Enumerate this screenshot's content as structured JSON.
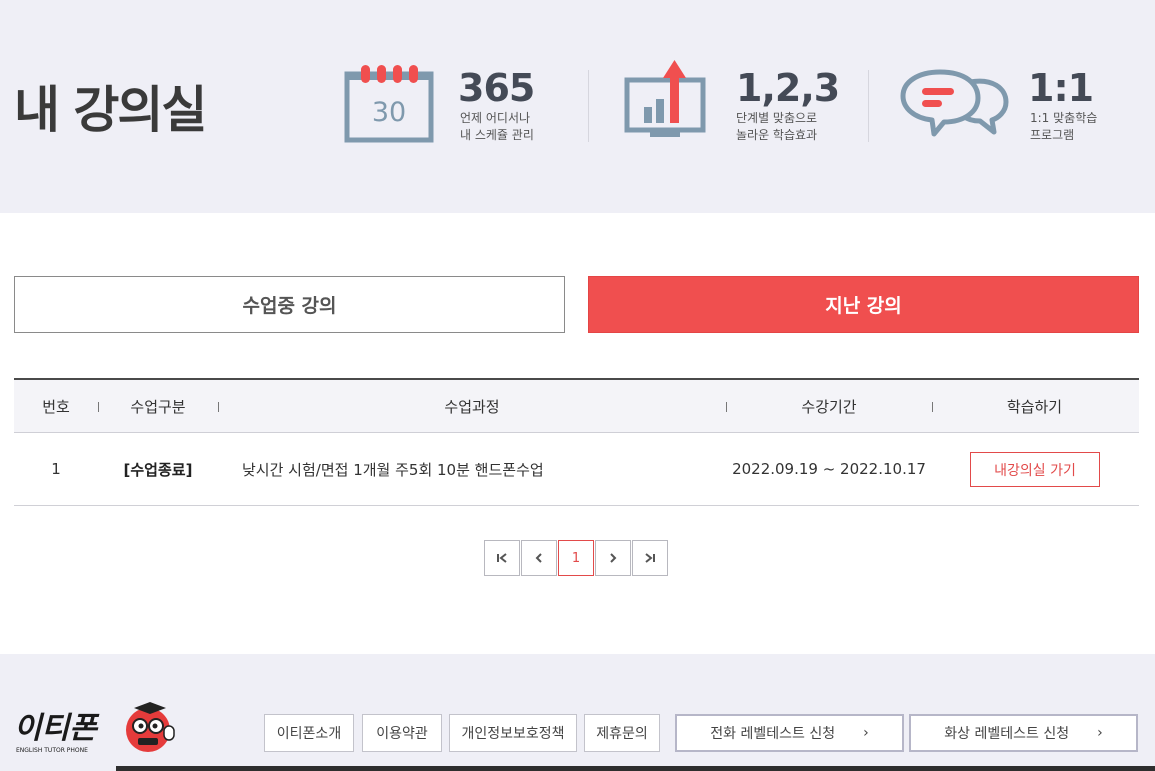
{
  "header": {
    "title": "내 강의실",
    "features": [
      {
        "icon": "calendar-icon",
        "calendar_day": "30",
        "big": "365",
        "line1": "언제 어디서나",
        "line2": "내 스케쥴 관리"
      },
      {
        "icon": "growth-monitor-icon",
        "big": "1,2,3",
        "line1": "단계별 맞춤으로",
        "line2": "놀라운 학습효과"
      },
      {
        "icon": "chat-bubbles-icon",
        "big": "1:1",
        "line1": "1:1 맞춤학습",
        "line2": "프로그램"
      }
    ]
  },
  "tabs": {
    "current": "수업중 강의",
    "past": "지난 강의",
    "active": "past"
  },
  "table": {
    "headers": [
      "번호",
      "수업구분",
      "수업과정",
      "수강기간",
      "학습하기"
    ],
    "rows": [
      {
        "no": "1",
        "type": "[수업종료]",
        "course": "낮시간 시험/면접 1개월 주5회 10분 핸드폰수업",
        "period": "2022.09.19 ~ 2022.10.17",
        "action": "내강의실 가기"
      }
    ]
  },
  "pagination": {
    "first": "|<",
    "prev": "<",
    "current_page": "1",
    "next": ">",
    "last": ">|"
  },
  "footer": {
    "logo_text": "이티폰",
    "logo_sub": "ENGLISH TUTOR PHONE",
    "links": [
      "이티폰소개",
      "이용약관",
      "개인정보보호정책",
      "제휴문의"
    ],
    "tests": [
      "전화 레벨테스트 신청",
      "화상 레벨테스트 신청"
    ],
    "arrow": "›"
  },
  "colors": {
    "accent": "#f04f4f",
    "icon_blue": "#7f99ad",
    "hero_bg": "#efeff6"
  }
}
